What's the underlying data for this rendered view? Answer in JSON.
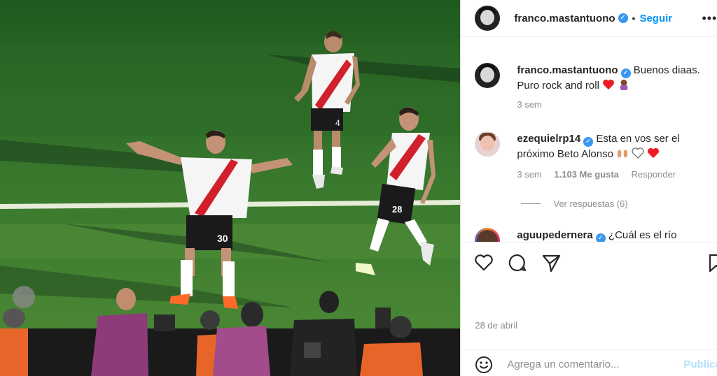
{
  "header": {
    "username": "franco.mastantuono",
    "separator": "•",
    "follow_label": "Seguir",
    "more": "•••"
  },
  "comments": [
    {
      "username": "franco.mastantuono",
      "text": "Buenos diaas. Puro rock and roll",
      "emoji": [
        "red-heart",
        "person-emoji"
      ],
      "time": "3 sem"
    },
    {
      "username": "ezequielrp14",
      "text": "Esta en vos ser el próximo Beto Alonso",
      "emoji": [
        "raised-hands",
        "white-heart",
        "red-heart"
      ],
      "time": "3 sem",
      "likes": "1.103 Me gusta",
      "reply": "Responder"
    },
    {
      "username": "aguupedernera",
      "text": "¿Cuál es el río"
    }
  ],
  "replies_label": "Ver respuestas (6)",
  "post_date": "28 de abril",
  "add_comment": {
    "placeholder": "Agrega un comentario...",
    "post_label": "Publicar"
  },
  "photo": {
    "jersey_number_center": "30",
    "jersey_number_back": "4",
    "jersey_number_right": "28"
  },
  "colors": {
    "accent": "#0095f6",
    "verified": "#3897f0",
    "muted": "#8e8e8e",
    "post_disabled": "#b2dffc",
    "heart_red": "#ed1c24",
    "pitch_green": "#2f6b2a",
    "jersey_red": "#d11f2b"
  }
}
